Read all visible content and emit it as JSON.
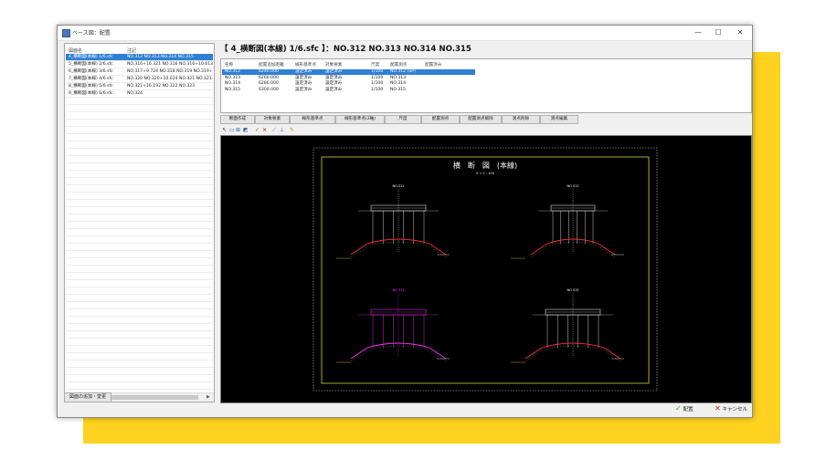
{
  "window": {
    "title": "ベース図：配置",
    "minimize": "—",
    "maximize": "☐",
    "close": "✕"
  },
  "left_panel": {
    "col_name": "図面名",
    "col_note": "注記",
    "rows": [
      {
        "name": "4_横断図(本線) 1/6.sfc",
        "note": "NO.312 NO.313 NO.314 NO.315",
        "selected": true
      },
      {
        "name": "5_横断図(本線) 2/6.sfc",
        "note": "NO.316+16.321 NO.316 NO.316+10.613 NO.3",
        "selected": false
      },
      {
        "name": "6_横断図(本線) 3/6.sfc",
        "note": "NO.317+9.724 NO.318 NO.319 NO.319+16.91",
        "selected": false
      },
      {
        "name": "7_横断図(本線) 4/6.sfc",
        "note": "NO.320 NO.320+10.024 NO.321 NO.321+12.2",
        "selected": false
      },
      {
        "name": "8_横断図(本線) 5/6.sfc",
        "note": "NO.321+16.192 NO.322 NO.323",
        "selected": false
      },
      {
        "name": "9_横断図(本線) 6/6.sfc",
        "note": "NO.324",
        "selected": false
      }
    ],
    "add_button": "図面の追加・変更"
  },
  "heading": "【 4_横断図(本線) 1/6.sfc 】：NO.312 NO.313 NO.314 NO.315",
  "table": {
    "headers": [
      "名称",
      "配置追加距離",
      "線形基準点",
      "対象要素",
      "尺度",
      "配置測点",
      "配置済み"
    ],
    "rows": [
      {
        "name": "NO.312",
        "dist": "6240.000",
        "base": "設定済み",
        "target": "設定済み",
        "scale": "1/100",
        "station": "NO.312 (SP)",
        "placed": "",
        "selected": true
      },
      {
        "name": "NO.313",
        "dist": "6260.000",
        "base": "設定済み",
        "target": "設定済み",
        "scale": "1/100",
        "station": "NO.313",
        "placed": "",
        "selected": false
      },
      {
        "name": "NO.314",
        "dist": "6280.000",
        "base": "設定済み",
        "target": "設定済み",
        "scale": "1/100",
        "station": "NO.314",
        "placed": "",
        "selected": false
      },
      {
        "name": "NO.315",
        "dist": "6300.000",
        "base": "設定済み",
        "target": "設定済み",
        "scale": "1/100",
        "station": "NO.315",
        "placed": "",
        "selected": false
      }
    ]
  },
  "buttons": [
    "断面作成",
    "対象要素",
    "線形基準点",
    "線形基準点(2軸)",
    "尺度",
    "配置測点",
    "配置測点解除",
    "測点削除",
    "測点編集"
  ],
  "tools": [
    "pointer-icon",
    "select-icon",
    "zoom-icon",
    "pan-icon",
    "check-icon",
    "cross-icon",
    "line-icon",
    "measure-icon",
    "pencil-icon"
  ],
  "drawing": {
    "title": "横　断　図　(本線)",
    "scale_text": "S = 1 : 100",
    "sections": [
      {
        "label": "NO.312"
      },
      {
        "label": "NO.313"
      },
      {
        "label": "NO.314"
      },
      {
        "label": "NO.315"
      }
    ],
    "colors": {
      "frame": "#d8d830",
      "section": "#ffffff",
      "ground": "#ff3030",
      "highlight": "#ff33ff"
    }
  },
  "footer": {
    "ok": "配置",
    "cancel": "キャンセル"
  }
}
